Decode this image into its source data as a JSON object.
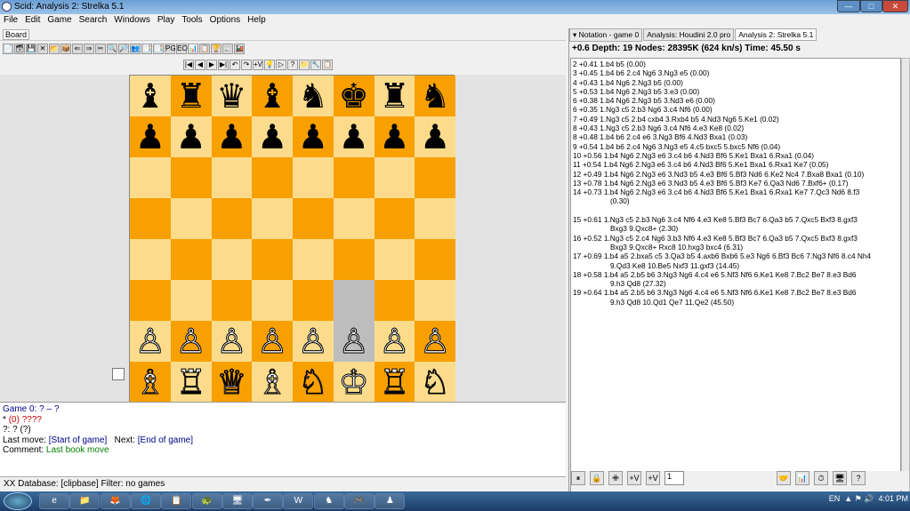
{
  "window": {
    "title": "Scid: Analysis 2: Strelka 5.1",
    "controls": [
      "—",
      "□",
      "✕"
    ]
  },
  "menu": [
    "File",
    "Edit",
    "Game",
    "Search",
    "Windows",
    "Play",
    "Tools",
    "Options",
    "Help"
  ],
  "left_tab": "Board",
  "toolbar1": [
    "📄",
    "🗃",
    "💾",
    "✕",
    "📂",
    "📦",
    "⇐",
    "⇒",
    "✂",
    "🔍",
    "🔎",
    "👥",
    "📑",
    "📑",
    "PGN",
    "ECO",
    "📊",
    "📋",
    "🏆",
    "📰",
    "🚂"
  ],
  "toolbar2": [
    "|◀",
    "◀",
    "▶",
    "▶|",
    "↶",
    "↷",
    "+V",
    "💡",
    "▷",
    "?",
    "📁",
    "🔧",
    "📋"
  ],
  "board": {
    "rows": [
      [
        "♝",
        "♜",
        "♛",
        "♝",
        "♞",
        "♚",
        "♜",
        "♞"
      ],
      [
        "♟",
        "♟",
        "♟",
        "♟",
        "♟",
        "♟",
        "♟",
        "♟"
      ],
      [
        "",
        "",
        "",
        "",
        "",
        "",
        "",
        ""
      ],
      [
        "",
        "",
        "",
        "",
        "",
        "",
        "",
        ""
      ],
      [
        "",
        "",
        "",
        "",
        "",
        "",
        "",
        ""
      ],
      [
        "",
        "",
        "",
        "",
        "",
        "",
        "",
        ""
      ],
      [
        "♙",
        "♙",
        "♙",
        "♙",
        "♙",
        "♙",
        "♙",
        "♙"
      ],
      [
        "♗",
        "♖",
        "♕",
        "♗",
        "♘",
        "♔",
        "♖",
        "♘"
      ]
    ],
    "colors": {
      "light": "#fcdc8c",
      "dark": "#f8a000",
      "highlight": "#bdbdbd"
    }
  },
  "game_info": {
    "line1_label": "Game 0:",
    "line1_value": "? – ?",
    "line2_star": "*",
    "line2_elo": "(0)",
    "line2_event": "????",
    "line3": "?:  ? (?)",
    "last_move_label": "Last move:",
    "last_move": "[Start of game]",
    "next_label": "Next:",
    "next": "[End of game]",
    "comment_label": "Comment:",
    "comment": "Last book move"
  },
  "status": "XX  Database: [clipbase]   Filter: no games",
  "right": {
    "tabs": [
      "▾ Notation - game 0",
      "Analysis: Houdini 2.0 pro",
      "Analysis 2: Strelka 5.1"
    ],
    "stat": "+0.6 Depth: 19 Nodes:  28395K (624 kn/s) Time:  45.50 s",
    "lines": [
      {
        "t": "2 +0.41 1.b4 b5  (0.00)"
      },
      {
        "t": "3 +0.45 1.b4 b6 2.c4 Ng6 3.Ng3 e5  (0.00)"
      },
      {
        "t": "4 +0.43 1.b4 Ng6 2.Ng3 b5  (0.00)"
      },
      {
        "t": "5 +0.53 1.b4 Ng6 2.Ng3 b5 3.e3  (0.00)"
      },
      {
        "t": "6 +0.38 1.b4 Ng6 2.Ng3 b5 3.Nd3 e6  (0.00)"
      },
      {
        "t": "6 +0.35 1.Ng3 c5 2.b3 Ng6 3.c4 Nf6  (0.00)"
      },
      {
        "t": "7 +0.49 1.Ng3 c5 2.b4 cxb4 3.Rxb4 b5 4.Nd3 Ng6 5.Ke1  (0.02)"
      },
      {
        "t": "8 +0.43 1.Ng3 c5 2.b3 Ng6 3.c4 Nf6 4.e3 Ke8  (0.02)"
      },
      {
        "t": "8 +0.48 1.b4 b6 2.c4 e6 3.Ng3 Bf6 4.Nd3 Bxa1  (0.03)"
      },
      {
        "t": "9 +0.54 1.b4 b6 2.c4 Ng6 3.Ng3 e5 4.c5 bxc5 5.bxc5 Nf6  (0.04)"
      },
      {
        "t": "10 +0.56 1.b4 Ng6 2.Ng3 e6 3.c4 b6 4.Nd3 Bf6 5.Ke1 Bxa1 6.Rxa1  (0.04)"
      },
      {
        "t": "11 +0.54 1.b4 Ng6 2.Ng3 e6 3.c4 b6 4.Nd3 Bf6 5.Ke1 Bxa1 6.Rxa1 Ke7  (0.05)"
      },
      {
        "t": "12 +0.49 1.b4 Ng6 2.Ng3 e6 3.Nd3 b5 4.e3 Bf6 5.Bf3 Nd6 6.Ke2 Nc4 7.Bxa8 Bxa1  (0.10)"
      },
      {
        "t": "13 +0.78 1.b4 Ng6 2.Ng3 e6 3.Nd3 b5 4.e3 Bf6 5.Bf3 Ke7 6.Qa3 Nd6 7.Bxf6+  (0.17)"
      },
      {
        "t": "14 +0.73 1.b4 Ng6 2.Ng3 e6 3.c4 b6 4.Nd3 Bf6 5.Ke1 Bxa1 6.Rxa1 Ke7 7.Qc3 Nd6 8.f3"
      },
      {
        "t": "(0.30)",
        "ind": true
      },
      {
        "t": ""
      },
      {
        "t": "15 +0.61 1.Ng3 c5 2.b3 Ng6 3.c4 Nf6 4.e3 Ke8 5.Bf3 Bc7 6.Qa3 b5 7.Qxc5 Bxf3 8.gxf3"
      },
      {
        "t": "Bxg3 9.Qxc8+  (2.30)",
        "ind": true
      },
      {
        "t": "16 +0.52 1.Ng3 c5 2.c4 Ng6 3.b3 Nf6 4.e3 Ke8 5.Bf3 Bc7 6.Qa3 b5 7.Qxc5 Bxf3 8.gxf3"
      },
      {
        "t": "Bxg3 9.Qxc8+ Rxc8 10.hxg3 bxc4  (6.31)",
        "ind": true
      },
      {
        "t": "17 +0.69 1.b4 a5 2.bxa5 c5 3.Qa3 b5 4.axb6 Bxb6 5.e3 Ng6 6.Bf3 Bc6 7.Ng3 Nf6 8.c4 Nh4"
      },
      {
        "t": "9.Qd3 Ke8 10.Be5 Nxf3 11.gxf3  (14.45)",
        "ind": true
      },
      {
        "t": "18 +0.58 1.b4 a5 2.b5 b6 3.Ng3 Ng6 4.c4 e6 5.Nf3 Nf6 6.Ke1 Ke8 7.Bc2 Be7 8.e3 Bd6"
      },
      {
        "t": "9.h3 Qd8  (27.32)",
        "ind": true
      },
      {
        "t": "19 +0.64 1.b4 a5 2.b5 b6 3.Ng3 Ng6 4.c4 e6 5.Nf3 Nf6 6.Ke1 Ke8 7.Bc2 Be7 8.e3 Bd6"
      },
      {
        "t": "9.h3 Qd8 10.Qd1 Qe7 11.Qe2  (45.50)",
        "ind": true
      }
    ],
    "toolbar": [
      "⏸",
      "🔒",
      "✙",
      "+V",
      "+V"
    ],
    "multipv": "1",
    "toolbar_right": [
      "🤝",
      "📊",
      "⏱",
      "🖥",
      "?"
    ]
  },
  "taskbar": {
    "apps": [
      "e",
      "📁",
      "🦊",
      "🌐",
      "📋",
      "🐢",
      "🖥",
      "✒",
      "W",
      "♞",
      "🎮",
      "♟"
    ],
    "lang": "EN",
    "time": "4:01 PM"
  }
}
